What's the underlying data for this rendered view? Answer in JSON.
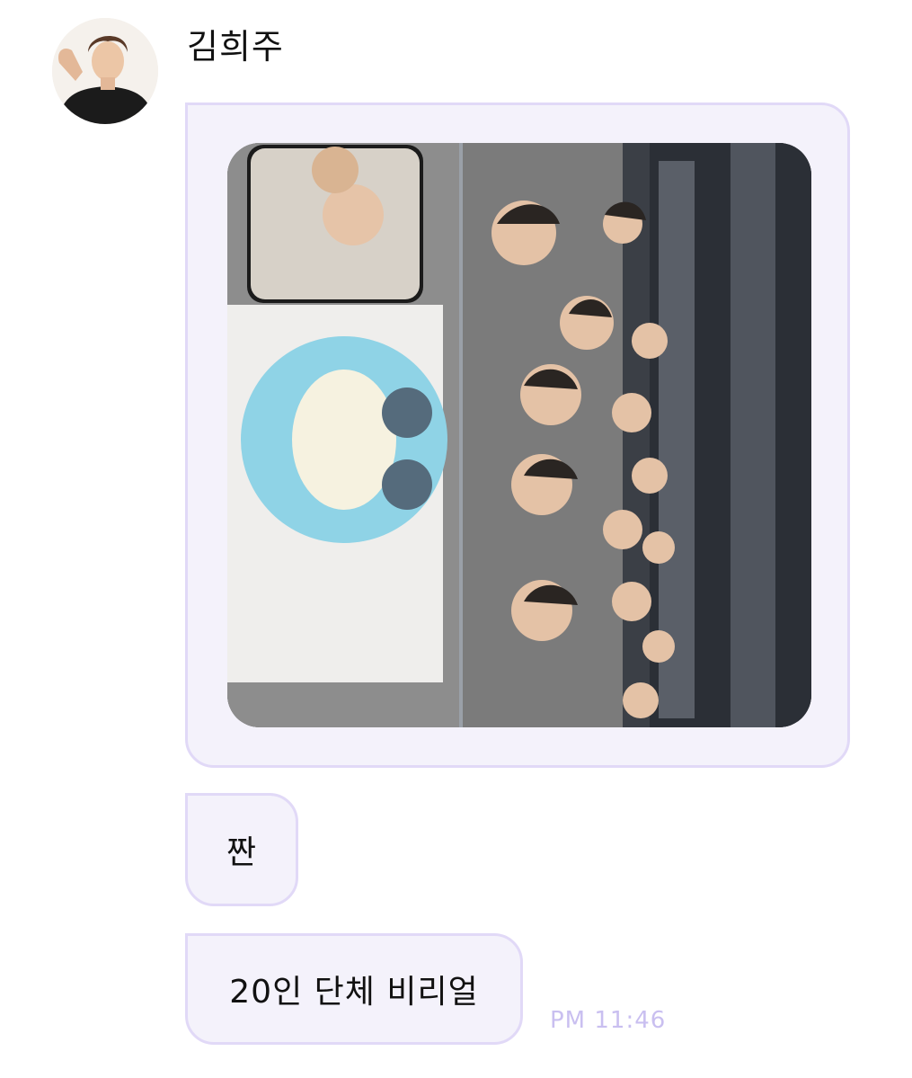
{
  "chat": {
    "sender_name": "김희주",
    "messages": [
      {
        "type": "image",
        "icon": "group-photo"
      },
      {
        "type": "text",
        "text": "짠"
      },
      {
        "type": "text",
        "text": "20인 단체 비리얼"
      }
    ],
    "timestamp": "PM 11:46"
  },
  "colors": {
    "bubble_background": "#f4f2fb",
    "bubble_border": "#e1d9f7",
    "timestamp": "#c9bff0",
    "text": "#111111"
  }
}
